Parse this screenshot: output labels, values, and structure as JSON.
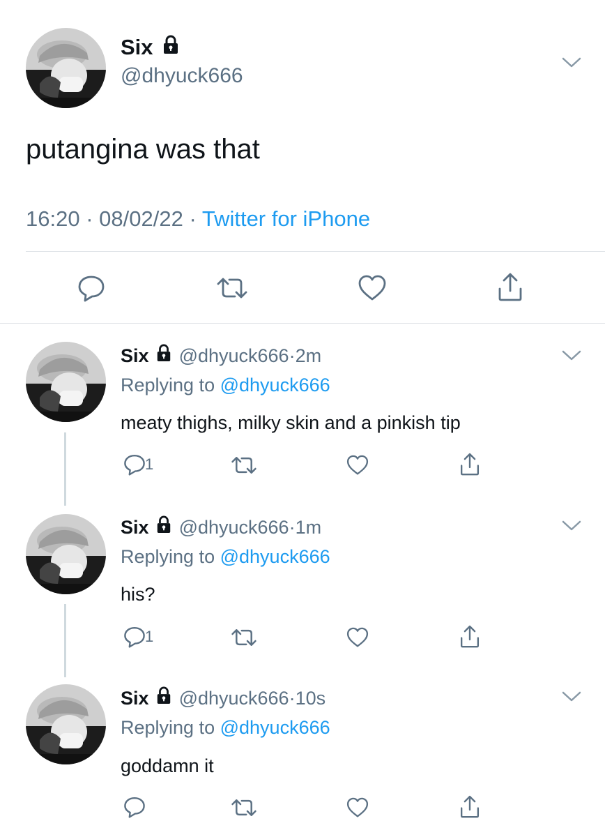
{
  "main_tweet": {
    "display_name": "Six",
    "handle": "@dhyuck666",
    "text": "putangina was that",
    "time": "16:20",
    "sep1": "·",
    "date": "08/02/22",
    "sep2": "·",
    "source": "Twitter for iPhone"
  },
  "replies": [
    {
      "display_name": "Six",
      "handle": "@dhyuck666",
      "sep": "·",
      "age": "2m",
      "replying_prefix": "Replying to",
      "replying_to": "@dhyuck666",
      "text": "meaty thighs, milky skin and a pinkish tip",
      "reply_count": "1"
    },
    {
      "display_name": "Six",
      "handle": "@dhyuck666",
      "sep": "·",
      "age": "1m",
      "replying_prefix": "Replying to",
      "replying_to": "@dhyuck666",
      "text": "his?",
      "reply_count": "1"
    },
    {
      "display_name": "Six",
      "handle": "@dhyuck666",
      "sep": "·",
      "age": "10s",
      "replying_prefix": "Replying to",
      "replying_to": "@dhyuck666",
      "text": "goddamn it",
      "reply_count": ""
    }
  ],
  "icons": {
    "lock": "lock-icon",
    "reply": "reply-icon",
    "retweet": "retweet-icon",
    "like": "heart-icon",
    "share": "share-icon",
    "more": "chevron-down-icon"
  },
  "colors": {
    "text": "#0f1419",
    "muted": "#5b7083",
    "link": "#1d9bf0",
    "divider": "#dfe3e7"
  }
}
